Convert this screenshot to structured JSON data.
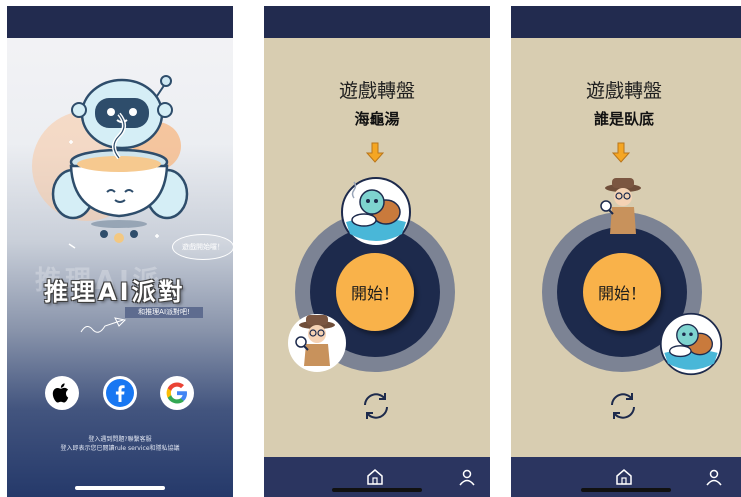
{
  "login": {
    "bubble_text": "遊戲開始囉！",
    "logo_title": "推理AI派對",
    "logo_ghost": "推理AI派",
    "logo_subtitle": "和推理AI派對吧!",
    "social_buttons": [
      "apple-icon",
      "facebook-icon",
      "google-icon"
    ],
    "legal_line1": "登入遇到問題?聯繫客服",
    "legal_line2": "登入即表示您已閱讀rule service和隱私協議"
  },
  "wheel_screens": [
    {
      "title": "遊戲轉盤",
      "game_name": "海龜湯",
      "start_label": "開始！",
      "top_avatar": "turtle-soup-avatar",
      "side_avatar": "detective-avatar"
    },
    {
      "title": "遊戲轉盤",
      "game_name": "誰是臥底",
      "start_label": "開始！",
      "top_avatar": "detective-avatar",
      "side_avatar": "turtle-soup-avatar"
    }
  ],
  "nav": {
    "items": [
      "home-icon",
      "profile-icon"
    ]
  },
  "colors": {
    "topbar": "#222b4f",
    "bottombar": "#2b3560",
    "wheel_bg": "#d8cdb1",
    "wheel_ring": "#7c8394",
    "wheel_inner": "#1d2a4c",
    "start_button": "#f9b24a",
    "arrow": "#f5a623"
  }
}
